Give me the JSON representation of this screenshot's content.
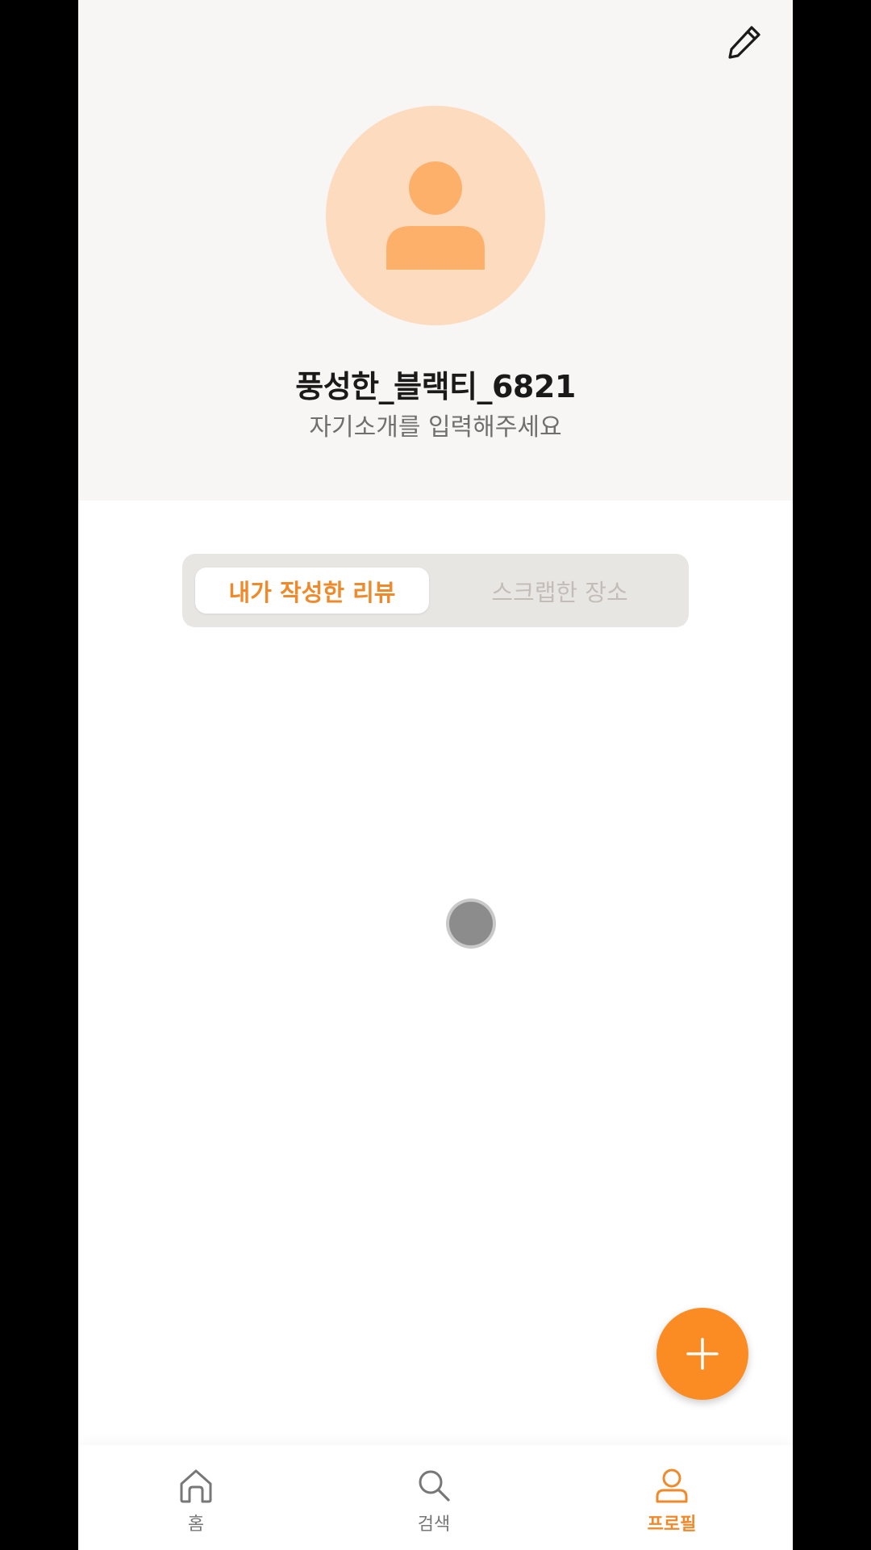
{
  "profile": {
    "username": "풍성한_블랙티_6821",
    "bio_placeholder": "자기소개를 입력해주세요"
  },
  "tabs": [
    {
      "label": "내가 작성한 리뷰",
      "active": true
    },
    {
      "label": "스크랩한 장소",
      "active": false
    }
  ],
  "bottom_nav": [
    {
      "label": "홈",
      "icon": "home-icon",
      "active": false
    },
    {
      "label": "검색",
      "icon": "search-icon",
      "active": false
    },
    {
      "label": "프로필",
      "icon": "profile-icon",
      "active": true
    }
  ],
  "colors": {
    "accent": "#fb8c24",
    "header_bg": "#f8f6f4",
    "avatar_bg": "#fddbbf",
    "avatar_fg": "#fdb06a"
  }
}
